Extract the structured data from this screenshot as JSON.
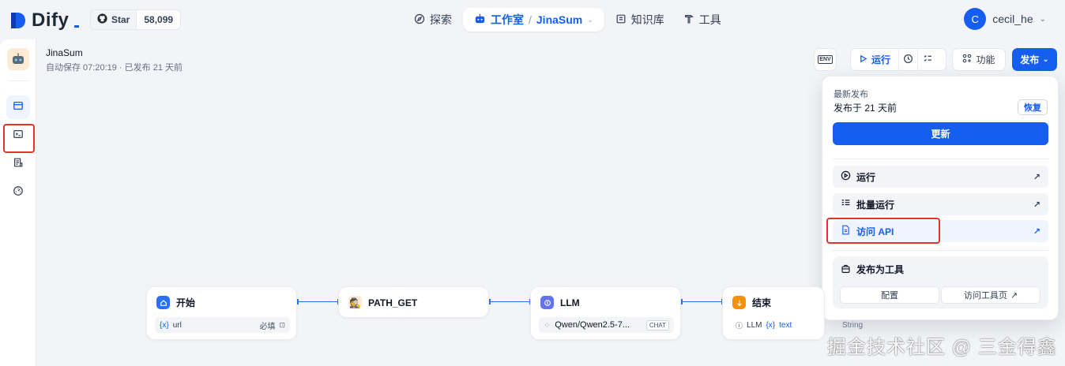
{
  "brand": {
    "name": "Dify",
    "accent": "#155eef"
  },
  "github": {
    "star_label": "Star",
    "count": "58,099"
  },
  "nav": {
    "explore": "探索",
    "studio": "工作室",
    "app": "JinaSum",
    "knowledge": "知识库",
    "tools": "工具"
  },
  "user": {
    "initial": "C",
    "name": "cecil_he"
  },
  "app": {
    "name": "JinaSum",
    "status": "自动保存 07:20:19 · 已发布 21 天前"
  },
  "toolbar": {
    "env": "ENV",
    "run": "运行",
    "features": "功能",
    "publish": "发布"
  },
  "publish_panel": {
    "latest_label": "最新发布",
    "published_time": "发布于 21 天前",
    "restore": "恢复",
    "update": "更新",
    "items": [
      {
        "label": "运行"
      },
      {
        "label": "批量运行"
      },
      {
        "label": "访问 API"
      }
    ],
    "tool_title": "发布为工具",
    "configure": "配置",
    "tool_page": "访问工具页"
  },
  "nodes": [
    {
      "title": "开始",
      "var_name": "url",
      "var_right": "必填"
    },
    {
      "title": "PATH_GET"
    },
    {
      "title": "LLM",
      "model": "Qwen/Qwen2.5-7...",
      "mode": "CHAT"
    },
    {
      "title": "结束",
      "src": "LLM",
      "var": "text",
      "type": "String"
    }
  ],
  "watermark": "掘金技术社区 @ 三金得鑫"
}
